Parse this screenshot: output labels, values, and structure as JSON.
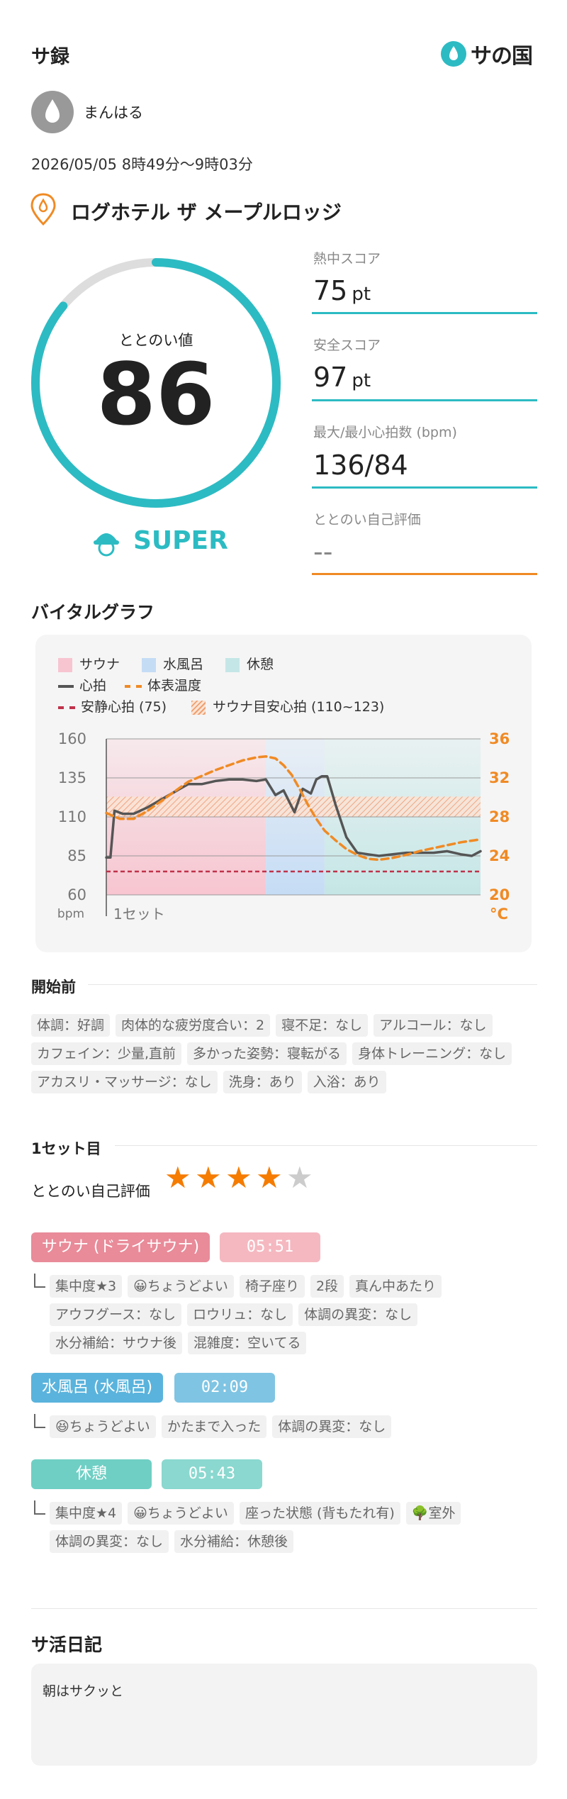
{
  "header": {
    "title": "サ録",
    "brand": "サの国"
  },
  "user": {
    "name": "まんはる"
  },
  "session": {
    "datetime": "2026/05/05 8時49分〜9時03分"
  },
  "facility": {
    "name": "ログホテル ザ メープルロッジ"
  },
  "score": {
    "label": "ととのい値",
    "value": "86",
    "rank": "SUPER",
    "ring_fraction": 0.86,
    "metrics": [
      {
        "label": "熱中スコア",
        "value": "75",
        "unit": "pt"
      },
      {
        "label": "安全スコア",
        "value": "97",
        "unit": "pt"
      },
      {
        "label": "最大/最小心拍数 (bpm)",
        "value": "136/84",
        "unit": ""
      },
      {
        "label": "ととのい自己評価",
        "value": "--",
        "unit": ""
      }
    ]
  },
  "vital": {
    "title": "バイタルグラフ",
    "legend": {
      "sauna": "サウナ",
      "mizuburo": "水風呂",
      "kyukei": "休憩",
      "heart": "心拍",
      "temp": "体表温度",
      "rest_hr": "安静心拍 (75)",
      "safe_zone": "サウナ目安心拍 (110~123)"
    },
    "y_left_ticks": [
      "160",
      "135",
      "110",
      "85",
      "60"
    ],
    "y_right_ticks": [
      "36",
      "32",
      "28",
      "24",
      "20"
    ],
    "y_left_unit": "bpm",
    "y_right_unit": "°C",
    "x_label": "1セット"
  },
  "chart_data": {
    "type": "line",
    "x_unit": "minutes from start",
    "phases": [
      {
        "name": "サウナ",
        "start": 0,
        "end": 5.85,
        "color": "#f7c5d0"
      },
      {
        "name": "水風呂",
        "start": 5.85,
        "end": 8.0,
        "color": "#c5dcf5"
      },
      {
        "name": "休憩",
        "start": 8.0,
        "end": 13.72,
        "color": "#c5e6e6"
      }
    ],
    "series": [
      {
        "name": "心拍",
        "axis": "left",
        "color": "#555555",
        "x": [
          0,
          0.15,
          0.3,
          0.6,
          1.0,
          1.5,
          2.0,
          2.5,
          3.0,
          3.5,
          4.0,
          4.5,
          5.0,
          5.5,
          5.85,
          6.2,
          6.5,
          6.9,
          7.2,
          7.5,
          7.7,
          7.9,
          8.1,
          8.4,
          8.8,
          9.2,
          9.6,
          10.0,
          10.5,
          11.0,
          11.5,
          12.0,
          12.5,
          13.0,
          13.4,
          13.72
        ],
        "y": [
          84,
          84,
          114,
          112,
          112,
          116,
          121,
          126,
          131,
          131,
          133,
          134,
          134,
          133,
          134,
          124,
          127,
          113,
          128,
          125,
          134,
          136,
          136,
          118,
          97,
          87,
          86,
          85,
          86,
          87,
          87,
          87,
          88,
          86,
          85,
          88
        ]
      },
      {
        "name": "体表温度",
        "axis": "right",
        "color": "#f08a24",
        "x": [
          0,
          0.5,
          1.0,
          1.5,
          2.0,
          2.5,
          3.0,
          3.5,
          4.0,
          4.5,
          5.0,
          5.5,
          5.85,
          6.2,
          6.5,
          6.8,
          7.1,
          7.4,
          7.7,
          8.0,
          8.4,
          8.8,
          9.2,
          9.6,
          10.0,
          10.5,
          11.0,
          11.5,
          12.0,
          12.5,
          13.0,
          13.5,
          13.72
        ],
        "y": [
          28.4,
          27.8,
          27.8,
          28.6,
          29.6,
          30.6,
          31.6,
          32.2,
          32.8,
          33.3,
          33.8,
          34.1,
          34.2,
          34.0,
          33.3,
          32.3,
          30.8,
          29.2,
          27.8,
          26.6,
          25.6,
          24.7,
          24.1,
          23.7,
          23.6,
          23.8,
          24.1,
          24.5,
          24.8,
          25.1,
          25.4,
          25.6,
          25.7
        ]
      }
    ],
    "reference": [
      {
        "name": "安静心拍 (75)",
        "axis": "left",
        "value": 75,
        "color": "#c0324a"
      }
    ],
    "bands": [
      {
        "name": "サウナ目安心拍 (110~123)",
        "axis": "left",
        "from": 110,
        "to": 123,
        "color": "#f0a070"
      }
    ],
    "ylim_left": [
      60,
      160
    ],
    "ylim_right": [
      20,
      36
    ],
    "xlim": [
      0,
      13.72
    ]
  },
  "before": {
    "title": "開始前",
    "chips": [
      "体調：好調",
      "肉体的な疲労度合い：2",
      "寝不足：なし",
      "アルコール：なし",
      "カフェイン：少量,直前",
      "多かった姿勢：寝転がる",
      "身体トレーニング：なし",
      "アカスリ・マッサージ：なし",
      "洗身：あり",
      "入浴：あり"
    ]
  },
  "set1": {
    "title": "1セット目",
    "rating_label": "ととのい自己評価",
    "rating": 4,
    "rating_max": 5,
    "steps": [
      {
        "label": "サウナ (ドライサウナ)",
        "time": "05:51",
        "color": "#e98b99",
        "chips": [
          "集中度★3",
          "😀ちょうどよい",
          "椅子座り",
          "2段",
          "真ん中あたり",
          "アウフグース：なし",
          "ロウリュ：なし",
          "体調の異変：なし",
          "水分補給：サウナ後",
          "混雑度：空いてる"
        ]
      },
      {
        "label": "水風呂 (水風呂)",
        "time": "02:09",
        "color": "#5ab3dc",
        "chips": [
          "😆ちょうどよい",
          "かたまで入った",
          "体調の異変：なし"
        ]
      },
      {
        "label": "休憩",
        "time": "05:43",
        "color": "#6fcfc4",
        "chips": [
          "集中度★4",
          "😀ちょうどよい",
          "座った状態 (背もたれ有)",
          "🌳室外",
          "体調の異変：なし",
          "水分補給：休憩後"
        ]
      }
    ]
  },
  "diary": {
    "title": "サ活日記",
    "text": "朝はサクッと"
  },
  "colors": {
    "teal": "#2cbbc3",
    "orange": "#f08a24",
    "gray_ring": "#dddddd"
  }
}
